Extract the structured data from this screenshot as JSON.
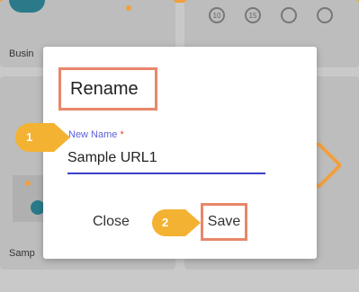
{
  "background": {
    "card_left_label": "Busin",
    "card_bottom_label": "Samp",
    "top_icons": [
      "10",
      "15",
      "",
      ""
    ]
  },
  "dialog": {
    "title": "Rename",
    "field_label": "New Name",
    "required_mark": "*",
    "field_value": "Sample URL1",
    "close_label": "Close",
    "save_label": "Save"
  },
  "callouts": [
    {
      "number": "1",
      "target": "new-name-field"
    },
    {
      "number": "2",
      "target": "save-button"
    }
  ],
  "colors": {
    "accent": "#f0a040",
    "highlight_box": "#e8876a",
    "callout": "#f3b232",
    "field_label": "#5a5fd8",
    "input_underline": "#3a3fc8"
  }
}
